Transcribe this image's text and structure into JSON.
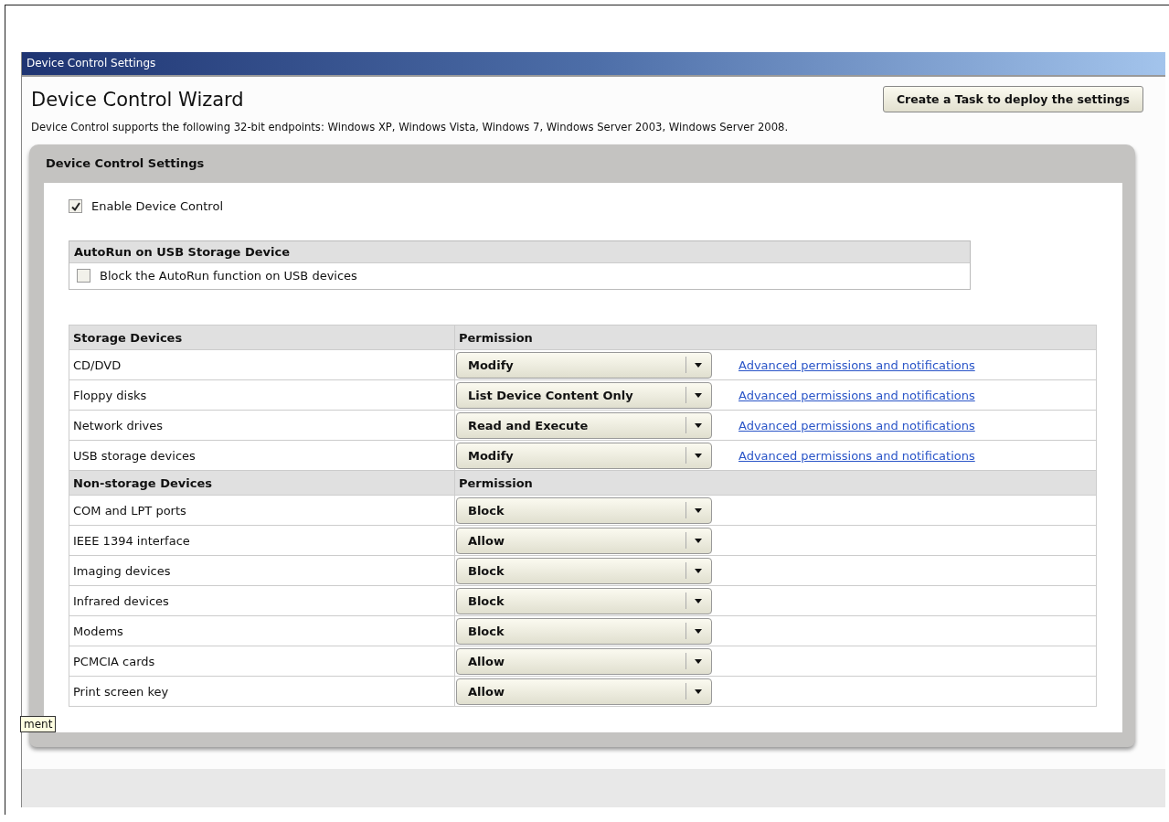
{
  "window": {
    "title": "Device Control Settings"
  },
  "wizard": {
    "title": "Device Control Wizard",
    "deploy_button": "Create a Task to deploy the settings",
    "note": "Device Control supports the following 32-bit endpoints: Windows XP, Windows Vista, Windows 7, Windows Server 2003, Windows Server 2008."
  },
  "panel": {
    "title": "Device Control Settings",
    "enable": {
      "label": "Enable Device Control",
      "checked": true
    },
    "autorun": {
      "heading": "AutoRun on USB Storage Device",
      "block": {
        "label": "Block the AutoRun function on USB devices",
        "checked": false
      }
    },
    "sections": [
      {
        "heading": "Storage Devices",
        "permission_heading": "Permission",
        "rows": [
          {
            "device": "CD/DVD",
            "permission": "Modify",
            "link": "Advanced permissions and notifications"
          },
          {
            "device": "Floppy disks",
            "permission": "List Device Content Only",
            "link": "Advanced permissions and notifications"
          },
          {
            "device": "Network drives",
            "permission": "Read and Execute",
            "link": "Advanced permissions and notifications"
          },
          {
            "device": "USB storage devices",
            "permission": "Modify",
            "link": "Advanced permissions and notifications"
          }
        ]
      },
      {
        "heading": "Non-storage Devices",
        "permission_heading": "Permission",
        "rows": [
          {
            "device": "COM and LPT ports",
            "permission": "Block"
          },
          {
            "device": "IEEE 1394 interface",
            "permission": "Allow"
          },
          {
            "device": "Imaging devices",
            "permission": "Block"
          },
          {
            "device": "Infrared devices",
            "permission": "Block"
          },
          {
            "device": "Modems",
            "permission": "Block"
          },
          {
            "device": "PCMCIA cards",
            "permission": "Allow"
          },
          {
            "device": "Print screen key",
            "permission": "Allow"
          }
        ]
      }
    ]
  },
  "tooltip": "ment"
}
